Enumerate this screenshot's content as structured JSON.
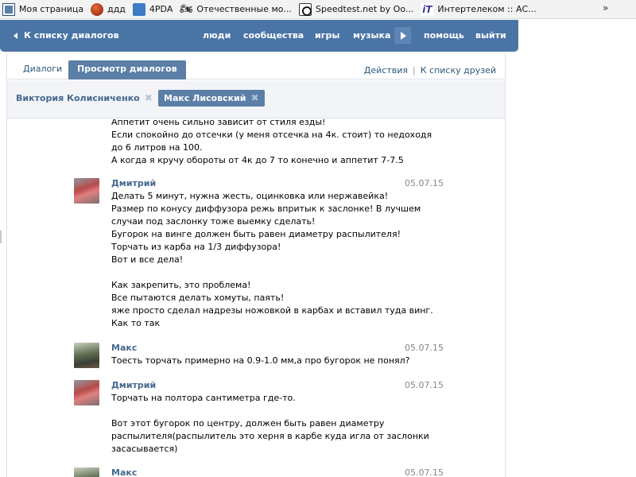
{
  "bookmarks": [
    {
      "icon": "vk-icon",
      "label": "Моя страница"
    },
    {
      "icon": "ball-icon",
      "label": "ддд"
    },
    {
      "icon": "4pda-icon",
      "label": "4PDA"
    },
    {
      "icon": "moto-icon",
      "label": "Отечественные мо..."
    },
    {
      "icon": "speedtest-icon",
      "label": "Speedtest.net by Oo..."
    },
    {
      "icon": "intertelecom-icon",
      "label": "Интертелеком :: АС..."
    }
  ],
  "bookmarks_more": "»",
  "header": {
    "back_label": "К списку диалогов",
    "nav": [
      "люди",
      "сообщества",
      "игры",
      "музыка",
      "помощь",
      "выйти"
    ]
  },
  "tabs": [
    {
      "label": "Диалоги",
      "active": false
    },
    {
      "label": "Просмотр диалогов",
      "active": true
    }
  ],
  "actions": {
    "action_label": "Действия",
    "separator": "|",
    "friends_label": "К списку друзей"
  },
  "participants": [
    {
      "name": "Виктория Колисниченко",
      "selected": false
    },
    {
      "name": "Макс Лисовский",
      "selected": true
    }
  ],
  "messages": {
    "m0": {
      "lines": [
        "Аппетит очень сильно зависит от стиля езды!",
        "Если спокойно до отсечки (у меня отсечка на 4к. стоит) то недоходя",
        "до 6 литров на 100.",
        "А когда я кручу обороты от 4к до 7 то конечно и аппетит 7-7.5"
      ]
    },
    "m1": {
      "author": "Дмитрий",
      "date": "05.07.15",
      "lines": [
        "Делать 5 минут, нужна жесть, оцинковка или нержавейка!",
        "Размер по конусу диффузора режь впритык к заслонке! В лучшем",
        "случаи под заслонку тоже выемку сделать!",
        "Бугорок на винге должен быть равен диаметру распылителя!",
        "Торчать из карба на 1/3 диффузора!",
        "Вот и все дела!",
        "",
        "Как закрепить, это проблема!",
        "Все пытаются делать хомуты, паять!",
        "яже просто сделал надрезы ножовкой в карбах и вставил туда винг.",
        "Как то так"
      ]
    },
    "m2": {
      "author": "Макс",
      "date": "05.07.15",
      "lines": [
        "Тоесть торчать примерно на 0.9-1.0 мм,а про бугорок не понял?"
      ]
    },
    "m3": {
      "author": "Дмитрий",
      "date": "05.07.15",
      "lines": [
        "Торчать на полтора сантиметра где-то.",
        "",
        "Вот этот бугорок по центру, должен быть равен диаметру",
        "распылителя(распылитель это херня в карбе куда игла от заслонки",
        "засасывается)"
      ]
    },
    "m4": {
      "author": "Макс",
      "date": "05.07.15"
    }
  },
  "colors": {
    "header": "#4a74a5",
    "link": "#2b587a",
    "author": "#45688e",
    "active_tab": "#5b7fa6"
  }
}
